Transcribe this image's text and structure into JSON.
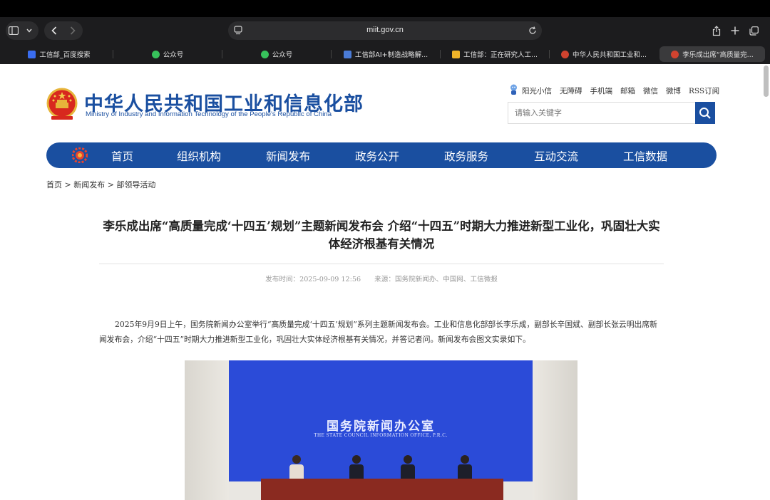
{
  "browser": {
    "url": "miit.gov.cn",
    "tabs": [
      {
        "label": "工信部_百度搜索",
        "active": false,
        "favicon_color": "#3a6df0"
      },
      {
        "label": "公众号",
        "active": false,
        "favicon_color": "#37c25b"
      },
      {
        "label": "公众号",
        "active": false,
        "favicon_color": "#37c25b"
      },
      {
        "label": "工信部AI+制造战略解...",
        "active": false,
        "favicon_color": "#4a7bd6"
      },
      {
        "label": "工信部：正在研究人工...",
        "active": false,
        "favicon_color": "#f0b429"
      },
      {
        "label": "中华人民共和国工业和...",
        "active": false,
        "favicon_color": "#d0432f"
      },
      {
        "label": "李乐成出席“高质量完...",
        "active": true,
        "favicon_color": "#d0432f"
      }
    ]
  },
  "header": {
    "title": "中华人民共和国工业和信息化部",
    "subtitle": "Ministry of Industry and Information Technology of the People's Republic of China",
    "utility_links": [
      "阳光小信",
      "无障碍",
      "手机端",
      "邮箱",
      "微信",
      "微博",
      "RSS订阅"
    ],
    "search_placeholder": "请输入关键字"
  },
  "nav": {
    "items": [
      "首页",
      "组织机构",
      "新闻发布",
      "政务公开",
      "政务服务",
      "互动交流",
      "工信数据"
    ]
  },
  "breadcrumb": "首页 > 新闻发布 > 部领导活动",
  "article": {
    "title": "李乐成出席“高质量完成‘十四五’规划”主题新闻发布会 介绍“十四五”时期大力推进新型工业化，巩固壮大实体经济根基有关情况",
    "publish_time": "发布时间：2025-09-09 12:56",
    "source": "来源：国务院新闻办、中国网、工信微报",
    "paragraph": "2025年9月9日上午，国务院新闻办公室举行“高质量完成‘十四五’规划”系列主题新闻发布会。工业和信息化部部长李乐成，副部长辛国斌、副部长张云明出席新闻发布会，介绍“十四五”时期大力推进新型工业化，巩固壮大实体经济根基有关情况，并答记者问。新闻发布会图文实录如下。",
    "photo": {
      "backdrop_cn": "国务院新闻办公室",
      "backdrop_en": "THE STATE COUNCIL INFORMATION OFFICE, P.R.C."
    }
  },
  "colors": {
    "brand_blue": "#1a4fa0",
    "backdrop_blue": "#2b4bd8"
  }
}
